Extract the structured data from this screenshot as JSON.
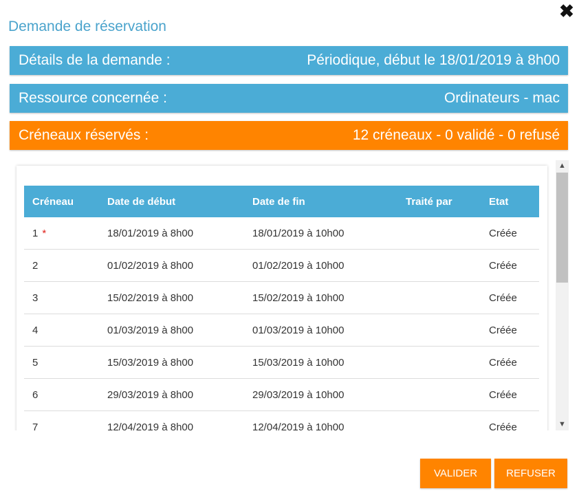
{
  "dialog": {
    "title": "Demande de réservation",
    "close_icon": "close-icon"
  },
  "details": {
    "label": "Détails de la demande :",
    "value": "Périodique, début le 18/01/2019 à 8h00"
  },
  "resource": {
    "label": "Ressource concernée :",
    "value": "Ordinateurs - mac"
  },
  "slots": {
    "label": "Créneaux réservés :",
    "value": "12 créneaux - 0 validé - 0 refusé"
  },
  "table": {
    "headers": [
      "Créneau",
      "Date de début",
      "Date de fin",
      "Traité par",
      "Etat"
    ],
    "rows": [
      {
        "num": "1",
        "star": "*",
        "start": "18/01/2019 à 8h00",
        "end": "18/01/2019 à 10h00",
        "by": "",
        "state": "Créée"
      },
      {
        "num": "2",
        "star": "",
        "start": "01/02/2019 à 8h00",
        "end": "01/02/2019 à 10h00",
        "by": "",
        "state": "Créée"
      },
      {
        "num": "3",
        "star": "",
        "start": "15/02/2019 à 8h00",
        "end": "15/02/2019 à 10h00",
        "by": "",
        "state": "Créée"
      },
      {
        "num": "4",
        "star": "",
        "start": "01/03/2019 à 8h00",
        "end": "01/03/2019 à 10h00",
        "by": "",
        "state": "Créée"
      },
      {
        "num": "5",
        "star": "",
        "start": "15/03/2019 à 8h00",
        "end": "15/03/2019 à 10h00",
        "by": "",
        "state": "Créée"
      },
      {
        "num": "6",
        "star": "",
        "start": "29/03/2019 à 8h00",
        "end": "29/03/2019 à 10h00",
        "by": "",
        "state": "Créée"
      },
      {
        "num": "7",
        "star": "",
        "start": "12/04/2019 à 8h00",
        "end": "12/04/2019 à 10h00",
        "by": "",
        "state": "Créée"
      }
    ]
  },
  "actions": {
    "validate": "VALIDER",
    "refuse": "REFUSER"
  },
  "colors": {
    "blue": "#4bacd6",
    "orange": "#ff8400",
    "title": "#4aa3cc",
    "required_star": "#e0201a"
  }
}
